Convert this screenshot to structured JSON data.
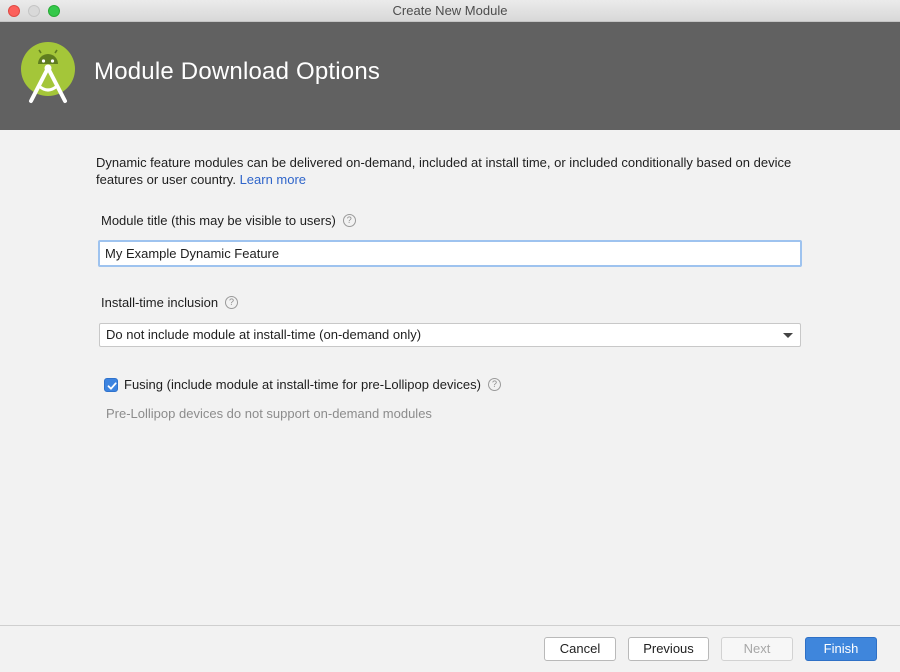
{
  "window": {
    "title": "Create New Module"
  },
  "banner": {
    "title": "Module Download Options",
    "logo": "android-studio-logo-icon",
    "background": "#616161"
  },
  "description": {
    "text": "Dynamic feature modules can be delivered on-demand, included at install time, or included conditionally based on device features or user country.",
    "link": "Learn more"
  },
  "module_title": {
    "label": "Module title (this may be visible to users)",
    "value": "My Example Dynamic Feature"
  },
  "install_time": {
    "label": "Install-time inclusion",
    "selected": "Do not include module at install-time (on-demand only)"
  },
  "fusing": {
    "label": "Fusing (include module at install-time for pre-Lollipop devices)",
    "checked": true,
    "hint": "Pre-Lollipop devices do not support on-demand modules"
  },
  "help_glyph": "?",
  "buttons": {
    "cancel": "Cancel",
    "previous": "Previous",
    "next": "Next",
    "finish": "Finish"
  },
  "colors": {
    "accent": "#3f86dc",
    "link": "#2f65ca",
    "android_green": "#a4c639"
  }
}
